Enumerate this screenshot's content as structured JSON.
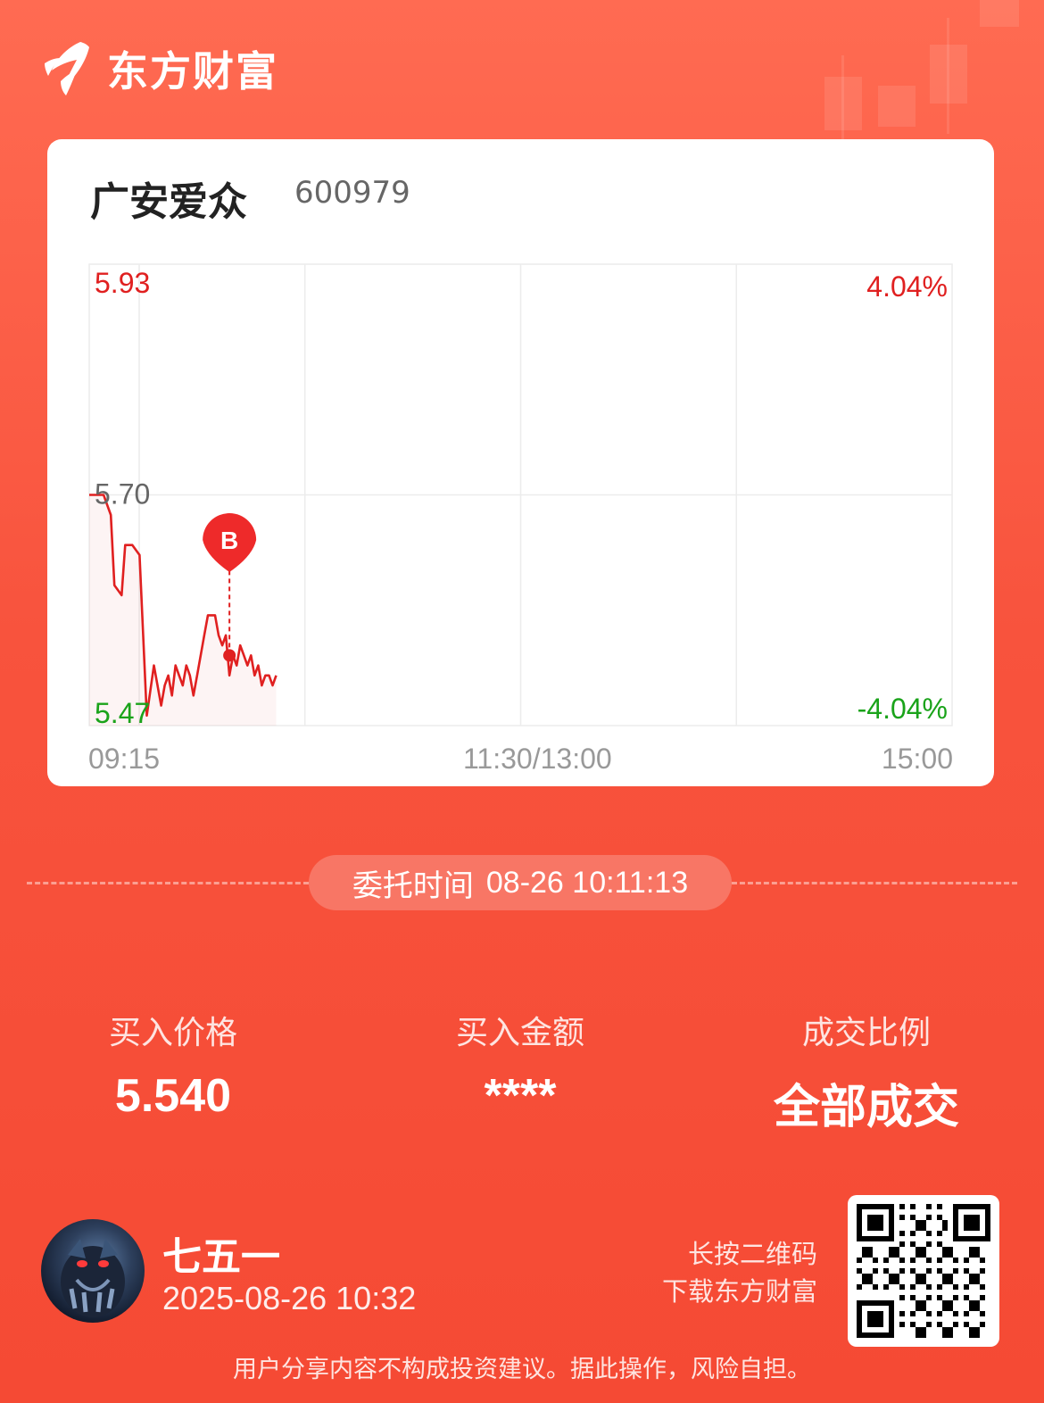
{
  "brand": {
    "name": "东方财富"
  },
  "stock": {
    "name": "广安爱众",
    "code": "600979"
  },
  "chart_data": {
    "type": "line",
    "y_labels": {
      "top": "5.93",
      "mid": "5.70",
      "bottom": "5.47"
    },
    "pct_labels": {
      "top": "4.04%",
      "bottom": "-4.04%"
    },
    "x_labels": [
      "09:15",
      "11:30/13:00",
      "15:00"
    ],
    "ylim": [
      5.47,
      5.93
    ],
    "prev_close": 5.7,
    "session_minutes": 240,
    "buy_marker": {
      "label": "B",
      "minute": 39,
      "price": 5.54
    },
    "series": [
      {
        "x": [
          0,
          2,
          4,
          5,
          6,
          7,
          9,
          10,
          11,
          12,
          14,
          16,
          18,
          20,
          21,
          22,
          23,
          24,
          25,
          26,
          27,
          28,
          29,
          30,
          31,
          32,
          33,
          34,
          35,
          36,
          37,
          38,
          39,
          40,
          41,
          42,
          43,
          44,
          45,
          46,
          47,
          48,
          49,
          50,
          51,
          52
        ],
        "y": [
          5.7,
          5.7,
          5.7,
          5.69,
          5.68,
          5.61,
          5.6,
          5.65,
          5.65,
          5.65,
          5.64,
          5.48,
          5.53,
          5.49,
          5.51,
          5.52,
          5.5,
          5.53,
          5.52,
          5.51,
          5.53,
          5.52,
          5.5,
          5.52,
          5.54,
          5.56,
          5.58,
          5.58,
          5.58,
          5.56,
          5.55,
          5.56,
          5.52,
          5.54,
          5.53,
          5.55,
          5.54,
          5.53,
          5.54,
          5.52,
          5.53,
          5.51,
          5.52,
          5.52,
          5.51,
          5.52
        ]
      }
    ],
    "grid": true,
    "line_color": "#e02020"
  },
  "order": {
    "label": "委托时间",
    "time": "08-26 10:11:13"
  },
  "stats": [
    {
      "label": "买入价格",
      "value": "5.540"
    },
    {
      "label": "买入金额",
      "value": "****"
    },
    {
      "label": "成交比例",
      "value": "全部成交"
    }
  ],
  "user": {
    "name": "七五一",
    "time": "2025-08-26 10:32"
  },
  "qr_hint": {
    "line1": "长按二维码",
    "line2": "下载东方财富"
  },
  "disclaimer": "用户分享内容不构成投资建议。据此操作，风险自担。"
}
